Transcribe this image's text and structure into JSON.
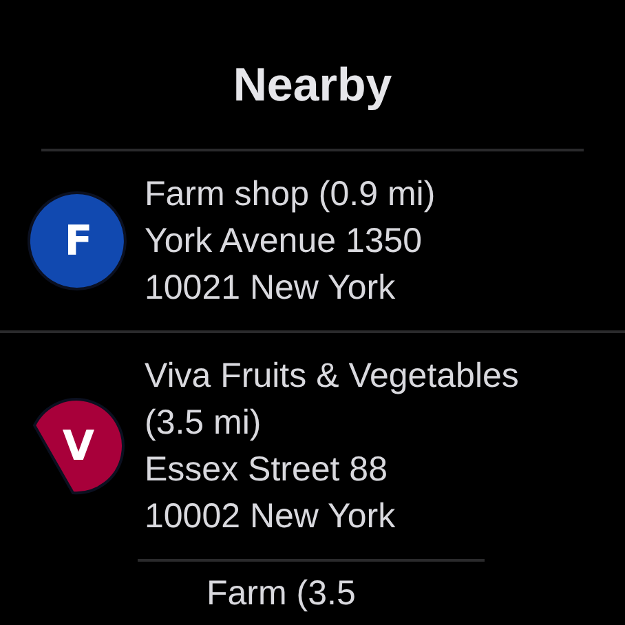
{
  "title": "Nearby",
  "places": [
    {
      "name": "Farm shop (0.9 mi)",
      "address": "York Avenue 1350",
      "city": "10021 New York",
      "initial": "F",
      "color": "#1149b0",
      "kind": "circle"
    },
    {
      "name": "Viva Fruits & Vegetables (3.5 mi)",
      "address": "Essex Street 88",
      "city": "10002 New York",
      "initial": "V",
      "color": "#a8003a",
      "kind": "cut"
    }
  ],
  "next_place": {
    "name": "Farm (3.5"
  }
}
